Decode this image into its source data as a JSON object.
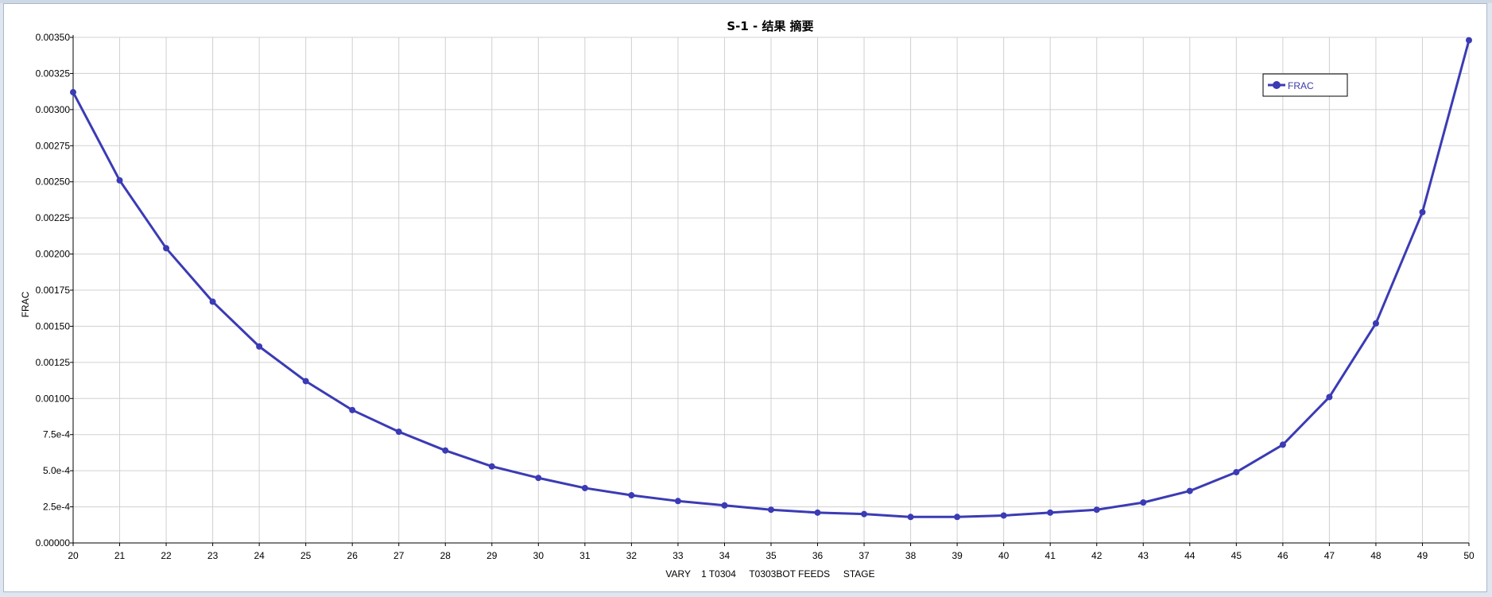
{
  "chart_data": {
    "type": "line",
    "title": "S-1 - 结果 摘要",
    "xlabel": "VARY    1 T0304     T0303BOT FEEDS     STAGE",
    "ylabel": "FRAC",
    "xlim": [
      20,
      50
    ],
    "ylim": [
      0,
      0.0035
    ],
    "x": [
      20,
      21,
      22,
      23,
      24,
      25,
      26,
      27,
      28,
      29,
      30,
      31,
      32,
      33,
      34,
      35,
      36,
      37,
      38,
      39,
      40,
      41,
      42,
      43,
      44,
      45,
      46,
      47,
      48,
      49,
      50
    ],
    "x_tick_labels": [
      "20",
      "21",
      "22",
      "23",
      "24",
      "25",
      "26",
      "27",
      "28",
      "29",
      "30",
      "31",
      "32",
      "33",
      "34",
      "35",
      "36",
      "37",
      "38",
      "39",
      "40",
      "41",
      "42",
      "43",
      "44",
      "45",
      "46",
      "47",
      "48",
      "49",
      "50"
    ],
    "y_ticks": [
      0,
      0.00025,
      0.0005,
      0.00075,
      0.001,
      0.00125,
      0.0015,
      0.00175,
      0.002,
      0.00225,
      0.0025,
      0.00275,
      0.003,
      0.00325,
      0.0035
    ],
    "y_tick_labels": [
      "0.00000",
      "2.5e-4",
      "5.0e-4",
      "7.5e-4",
      "0.00100",
      "0.00125",
      "0.00150",
      "0.00175",
      "0.00200",
      "0.00225",
      "0.00250",
      "0.00275",
      "0.00300",
      "0.00325",
      "0.00350"
    ],
    "grid": true,
    "legend_position": "top-right",
    "series": [
      {
        "name": "FRAC",
        "color": "#3b3bb5",
        "values": [
          0.00312,
          0.00251,
          0.00204,
          0.00167,
          0.00136,
          0.00112,
          0.00092,
          0.00077,
          0.00064,
          0.00053,
          0.00045,
          0.00038,
          0.00033,
          0.00029,
          0.00026,
          0.00023,
          0.00021,
          0.0002,
          0.00018,
          0.00018,
          0.00019,
          0.00021,
          0.00023,
          0.00028,
          0.00036,
          0.00049,
          0.00068,
          0.00101,
          0.00152,
          0.00229,
          0.00348
        ]
      }
    ]
  }
}
